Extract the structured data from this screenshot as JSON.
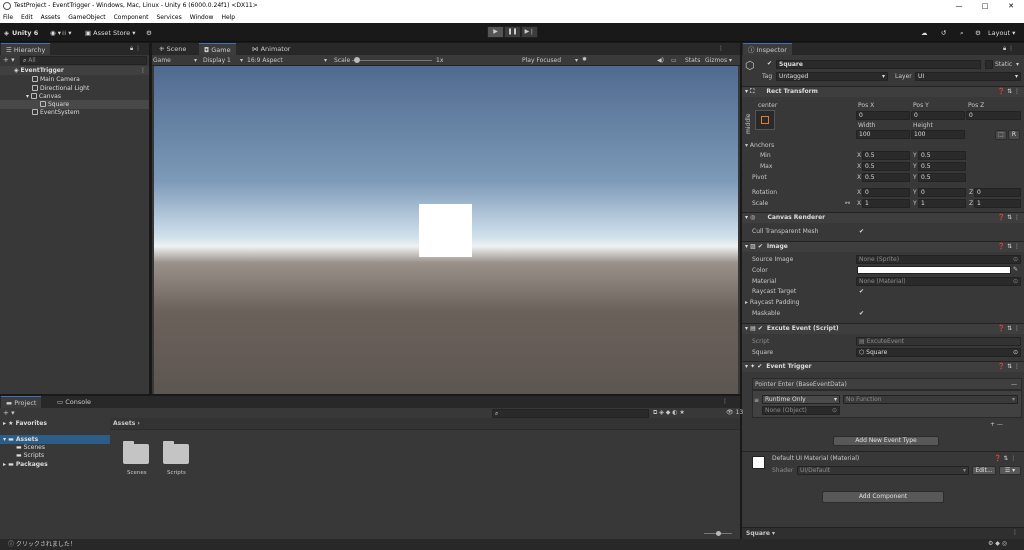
{
  "window": {
    "title": "TestProject - EventTrigger - Windows, Mac, Linux - Unity 6 (6000.0.24f1) <DX11>",
    "minimize": "—",
    "maximize": "□",
    "close": "✕"
  },
  "menu": [
    "File",
    "Edit",
    "Assets",
    "GameObject",
    "Component",
    "Services",
    "Window",
    "Help"
  ],
  "toolbar": {
    "account": "Unity 6",
    "asset_store": "Asset Store ▾",
    "layout": "Layout ▾"
  },
  "hierarchy": {
    "tab": "Hierarchy",
    "search_placeholder": "All",
    "items": [
      {
        "label": "EventTrigger",
        "depth": 0
      },
      {
        "label": "Main Camera",
        "depth": 1
      },
      {
        "label": "Directional Light",
        "depth": 1
      },
      {
        "label": "Canvas",
        "depth": 1
      },
      {
        "label": "Square",
        "depth": 2
      },
      {
        "label": "EventSystem",
        "depth": 1
      }
    ]
  },
  "scene_tabs": [
    "Scene",
    "Game",
    "Animator"
  ],
  "game_bar": {
    "display_mode": "Game",
    "display": "Display 1",
    "aspect": "16:9 Aspect",
    "scale_label": "Scale",
    "scale_value": "1x",
    "play_mode": "Play Focused",
    "stats": "Stats",
    "gizmos": "Gizmos"
  },
  "inspector": {
    "tab": "Inspector",
    "object_name": "Square",
    "static_label": "Static",
    "tag_label": "Tag",
    "tag_value": "Untagged",
    "layer_label": "Layer",
    "layer_value": "UI",
    "rect_transform": {
      "title": "Rect Transform",
      "anchor_h": "center",
      "anchor_v": "middle",
      "pos_x_label": "Pos X",
      "pos_y_label": "Pos Y",
      "pos_z_label": "Pos Z",
      "pos_x": "0",
      "pos_y": "0",
      "pos_z": "0",
      "width_label": "Width",
      "height_label": "Height",
      "width": "100",
      "height": "100",
      "blueprint": "⬚",
      "raw": "R",
      "anchors_label": "Anchors",
      "min_label": "Min",
      "max_label": "Max",
      "pivot_label": "Pivot",
      "min_x": "0.5",
      "min_y": "0.5",
      "max_x": "0.5",
      "max_y": "0.5",
      "pivot_x": "0.5",
      "pivot_y": "0.5",
      "rotation_label": "Rotation",
      "scale_label": "Scale",
      "rot_x": "0",
      "rot_y": "0",
      "rot_z": "0",
      "scale_x": "1",
      "scale_y": "1",
      "scale_z": "1",
      "x": "X",
      "y": "Y",
      "z": "Z"
    },
    "canvas_renderer": {
      "title": "Canvas Renderer",
      "cull_label": "Cull Transparent Mesh"
    },
    "image": {
      "title": "Image",
      "source_label": "Source Image",
      "source_value": "None (Sprite)",
      "color_label": "Color",
      "material_label": "Material",
      "material_value": "None (Material)",
      "raycast_label": "Raycast Target",
      "padding_label": "Raycast Padding",
      "maskable_label": "Maskable"
    },
    "script_comp": {
      "title": "Excute Event (Script)",
      "script_label": "Script",
      "script_value": "ExcuteEvent",
      "square_label": "Square",
      "square_value": "Square"
    },
    "event_trigger": {
      "title": "Event Trigger",
      "entry": "Pointer Enter (BaseEventData)",
      "runtime": "Runtime Only",
      "function": "No Function",
      "object": "None (Object)",
      "add_button": "Add New Event Type"
    },
    "material": {
      "title": "Default UI Material (Material)",
      "shader_label": "Shader",
      "shader_value": "UI/Default",
      "edit": "Edit...",
      "list": "☰ ▾"
    },
    "add_component": "Add Component",
    "footer": "Square ▾"
  },
  "project": {
    "tabs": [
      "Project",
      "Console"
    ],
    "favorites": "Favorites",
    "assets": "Assets",
    "scenes": "Scenes",
    "scripts": "Scripts",
    "packages": "Packages",
    "breadcrumb": "Assets",
    "hidden_count": "13",
    "folders": [
      "Scenes",
      "Scripts"
    ]
  },
  "status": {
    "message": "クリックされました！"
  },
  "colors": {
    "accent": "#3d6fba",
    "selection": "#2c5d87"
  }
}
